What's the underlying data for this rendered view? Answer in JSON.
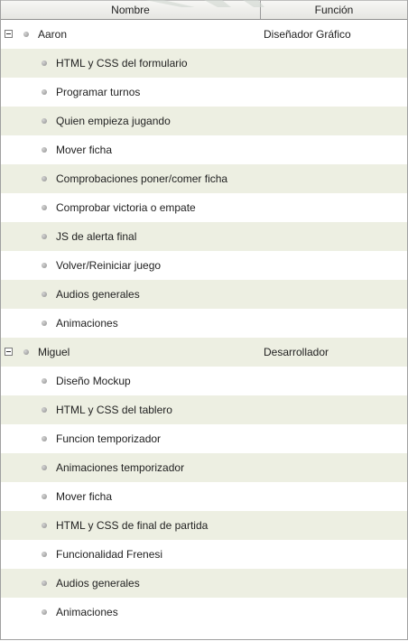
{
  "columns": {
    "name": "Nombre",
    "role": "Función"
  },
  "groups": [
    {
      "name": "Aaron",
      "role": "Diseñador Gráfico",
      "tasks": [
        "HTML y CSS del formulario",
        "Programar turnos",
        "Quien empieza jugando",
        "Mover ficha",
        "Comprobaciones poner/comer ficha",
        "Comprobar victoria o empate",
        "JS de alerta final",
        "Volver/Reiniciar juego",
        "Audios generales",
        "Animaciones"
      ]
    },
    {
      "name": "Miguel",
      "role": "Desarrollador",
      "tasks": [
        "Diseño Mockup",
        "HTML y CSS del tablero",
        "Funcion temporizador",
        "Animaciones temporizador",
        "Mover ficha",
        "HTML y CSS de final de partida",
        "Funcionalidad Frenesi",
        "Audios generales",
        "Animaciones"
      ]
    }
  ]
}
